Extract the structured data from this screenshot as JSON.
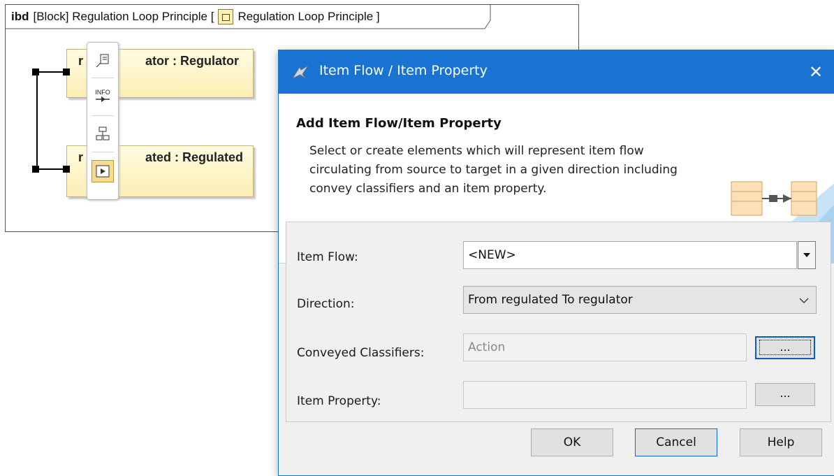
{
  "diagram": {
    "frame_kind": "ibd",
    "frame_title_prefix": "[Block] Regulation Loop Principle [",
    "frame_title_name": "Regulation Loop Principle ]",
    "parts": [
      {
        "prefix": "r",
        "label": "ator : Regulator"
      },
      {
        "prefix": "r",
        "label": "ated : Regulated"
      }
    ],
    "toolbar": {
      "info_label": "INFO"
    }
  },
  "dialog": {
    "title": "Item Flow / Item Property",
    "close_glyph": "✕",
    "header_title": "Add Item Flow/Item Property",
    "header_description": "Select or create elements which will represent item flow circulating from source to target in a given direction including convey classifiers and an item property.",
    "fields": {
      "item_flow": {
        "label": "Item Flow:",
        "value": "<NEW>"
      },
      "direction": {
        "label": "Direction:",
        "value": "From regulated To regulator"
      },
      "conveyed_classifiers": {
        "label": "Conveyed Classifiers:",
        "value": "Action",
        "button": "..."
      },
      "item_property": {
        "label": "Item Property:",
        "value": "",
        "button": "..."
      }
    },
    "buttons": {
      "ok": "OK",
      "cancel": "Cancel",
      "help": "Help"
    },
    "colors": {
      "titlebar": "#1873d3",
      "accent": "#0a68d0"
    }
  }
}
